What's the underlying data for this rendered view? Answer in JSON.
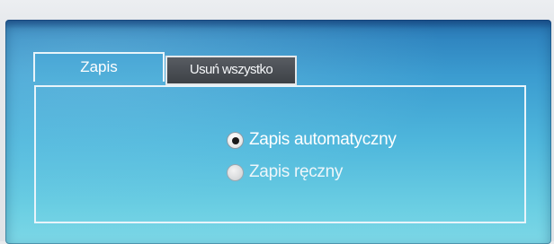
{
  "tabs": [
    {
      "label": "Zapis",
      "active": true
    },
    {
      "label": "Usuń wszystko",
      "active": false
    }
  ],
  "save_mode": {
    "options": [
      {
        "label": "Zapis automatyczny",
        "selected": true
      },
      {
        "label": "Zapis ręczny",
        "selected": false
      }
    ]
  },
  "colors": {
    "panel_top": "#2a7ab8",
    "panel_bottom": "#7cd7e6",
    "inactive_tab": "#4a4e54",
    "text": "#ffffff"
  }
}
